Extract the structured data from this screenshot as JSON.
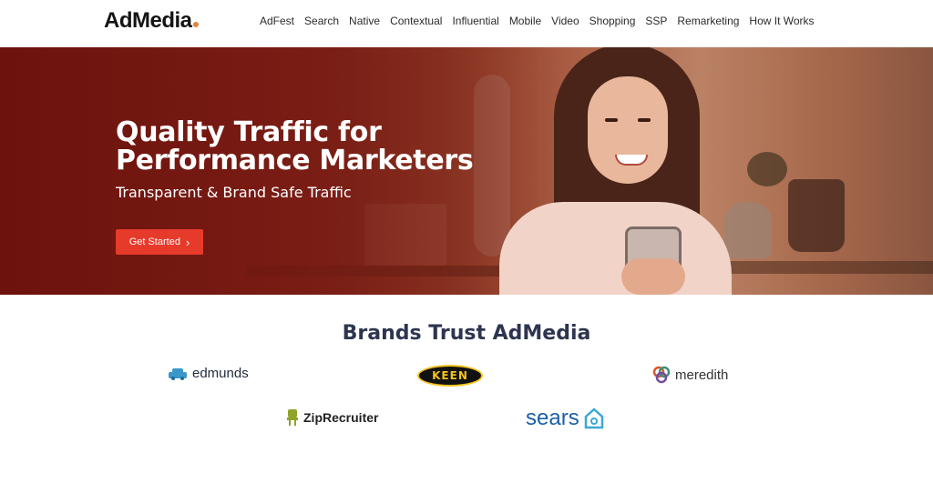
{
  "header": {
    "logo": "AdMedia",
    "nav": [
      "AdFest",
      "Search",
      "Native",
      "Contextual",
      "Influential",
      "Mobile",
      "Video",
      "Shopping",
      "SSP",
      "Remarketing",
      "How It Works"
    ]
  },
  "hero": {
    "title_line1": "Quality Traffic for",
    "title_line2": "Performance Marketers",
    "subtitle": "Transparent & Brand Safe Traffic",
    "cta_label": "Get Started"
  },
  "brands": {
    "title": "Brands Trust AdMedia",
    "logos": [
      "edmunds",
      "KEEN",
      "meredith",
      "ZipRecruiter",
      "sears"
    ]
  },
  "colors": {
    "accent": "#e63a2b",
    "hero_bg": "#7e1f15",
    "brand_title": "#2d3550",
    "logo_dot": "#e8823a"
  }
}
